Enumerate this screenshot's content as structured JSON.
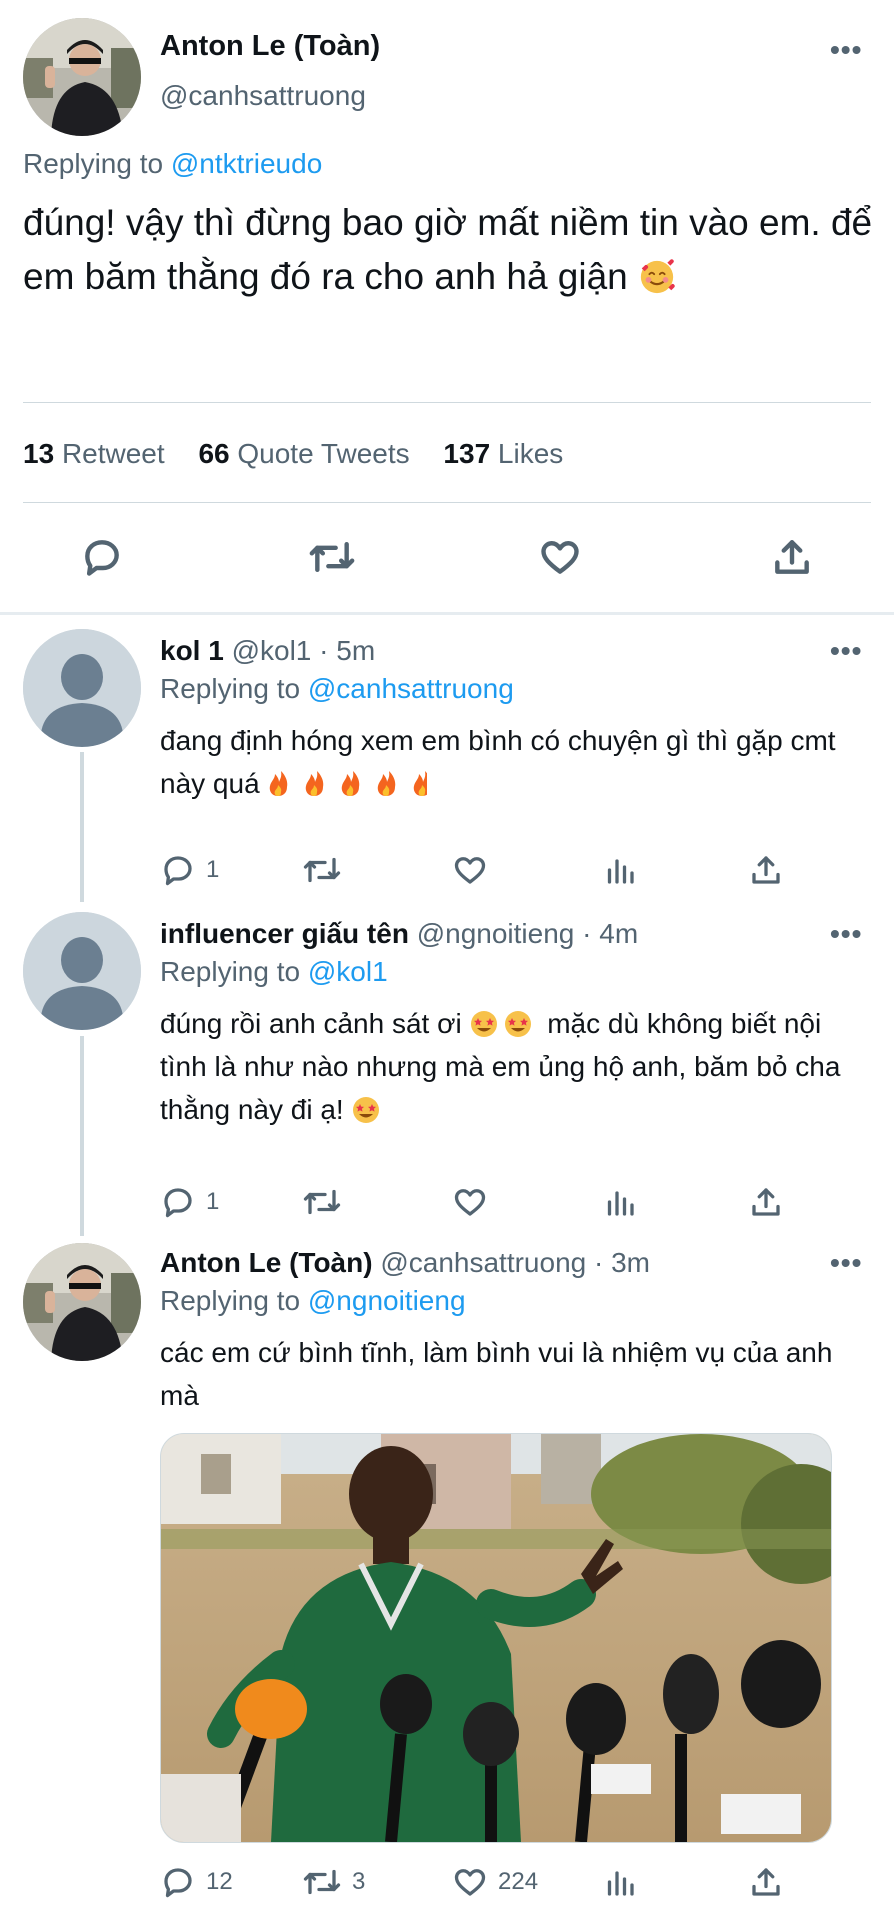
{
  "main_tweet": {
    "author_name": "Anton Le (Toàn)",
    "author_handle": "@canhsattruong",
    "replying_prefix": "Replying to",
    "replying_to": "@ntktrieudo",
    "text": "đúng! vậy thì đừng bao giờ mất niềm tin vào em. để em băm thằng đó ra cho anh hả giận",
    "emoji": "smiling-face-with-hearts",
    "stats": {
      "retweets_count": "13",
      "retweets_label": "Retweet",
      "quotes_count": "66",
      "quotes_label": "Quote Tweets",
      "likes_count": "137",
      "likes_label": "Likes"
    }
  },
  "replies": [
    {
      "name": "kol 1",
      "meta": "@kol1 · 5m",
      "replying_prefix": "Replying to",
      "replying_to": "@canhsattruong",
      "text": "đang định hóng xem em bình có chuyện gì thì gặp cmt này quá",
      "emojis": [
        "fire",
        "fire",
        "fire",
        "fire",
        "fire"
      ],
      "reply_count": "1",
      "retweet_count": "",
      "like_count": ""
    },
    {
      "name": "influencer giấu tên",
      "meta": "@ngnoitieng · 4m",
      "replying_prefix": "Replying to",
      "replying_to": "@kol1",
      "text_part1": "đúng rồi anh cảnh sát ơi",
      "text_part2": "mặc dù không biết nội tình là như nào nhưng mà em ủng hộ anh, băm bỏ cha thằng này đi ạ!",
      "emojis": [
        "star-struck",
        "star-struck",
        "star-struck"
      ],
      "reply_count": "1",
      "retweet_count": "",
      "like_count": ""
    },
    {
      "name": "Anton Le (Toàn)",
      "meta": "@canhsattruong · 3m",
      "replying_prefix": "Replying to",
      "replying_to": "@ngnoitieng",
      "text": "các em cứ bình tĩnh, làm bình vui là nhiệm vụ của anh mà",
      "media": "photo-boy-press-microphones",
      "reply_count": "12",
      "retweet_count": "3",
      "like_count": "224"
    }
  ],
  "icons": {
    "reply": "reply-icon",
    "retweet": "retweet-icon",
    "like": "heart-icon",
    "share": "share-icon",
    "analytics": "analytics-icon",
    "more": "more-icon"
  },
  "colors": {
    "accent": "#1d9bf0",
    "muted": "#536471",
    "text": "#0f1419",
    "divider": "#cfd9de"
  }
}
